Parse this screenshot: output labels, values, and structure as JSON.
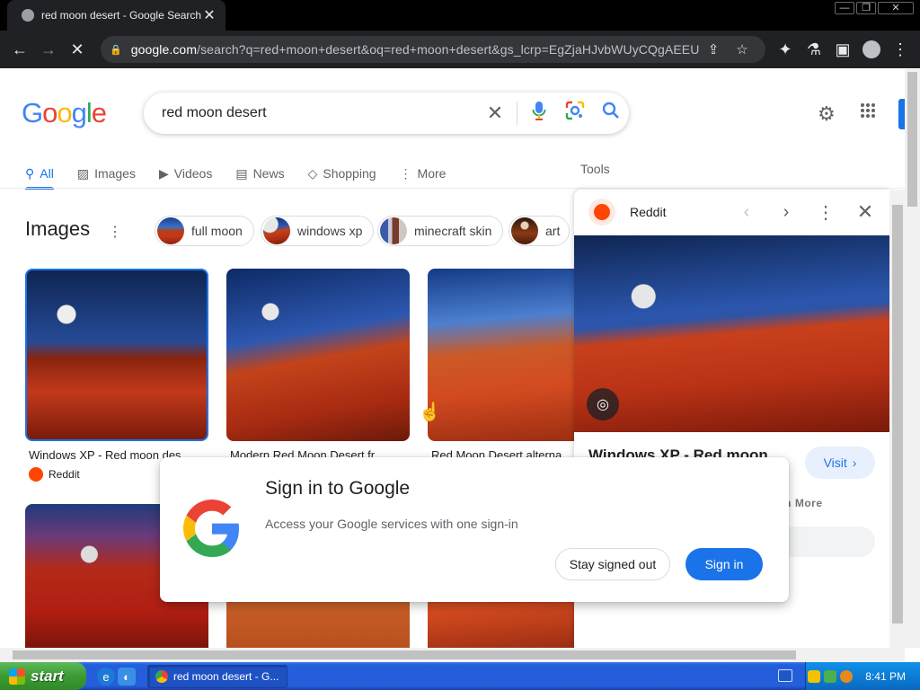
{
  "browser": {
    "tab_title": "red moon desert - Google Search",
    "tab_close": "✕",
    "url_domain": "google.com",
    "url_rest": "/search?q=red+moon+desert&oq=red+moon+desert&gs_lcrp=EgZjaHJvbWUyCQgAEEU...",
    "window_controls": [
      "—",
      "❐",
      "✕"
    ]
  },
  "search": {
    "query": "red moon desert"
  },
  "logo": {
    "letters": [
      "G",
      "o",
      "o",
      "g",
      "l",
      "e"
    ]
  },
  "nav": {
    "tabs": [
      {
        "label": "All",
        "icon": "search-icon"
      },
      {
        "label": "Images",
        "icon": "image-icon"
      },
      {
        "label": "Videos",
        "icon": "play-icon"
      },
      {
        "label": "News",
        "icon": "news-icon"
      },
      {
        "label": "Shopping",
        "icon": "tag-icon"
      },
      {
        "label": "More",
        "icon": "more-icon"
      }
    ],
    "tools": "Tools"
  },
  "images": {
    "title": "Images",
    "chips": [
      "full moon",
      "windows xp",
      "minecraft skin",
      "art"
    ],
    "results": [
      {
        "caption": "Windows XP - Red moon des...",
        "source": "Reddit"
      },
      {
        "caption": "Modern Red Moon Desert fr...",
        "source": ""
      },
      {
        "caption": "Red Moon Desert alterna...",
        "source": ""
      }
    ]
  },
  "panel": {
    "source": "Reddit",
    "title": "Windows XP - Red moon",
    "visit": "Visit",
    "learn_more": "rn More"
  },
  "dialog": {
    "title": "Sign in to Google",
    "subtitle": "Access your Google services with one sign-in",
    "stay_signed_out": "Stay signed out",
    "sign_in": "Sign in"
  },
  "taskbar": {
    "start": "start",
    "item": "red moon desert - G...",
    "time": "8:41 PM"
  }
}
